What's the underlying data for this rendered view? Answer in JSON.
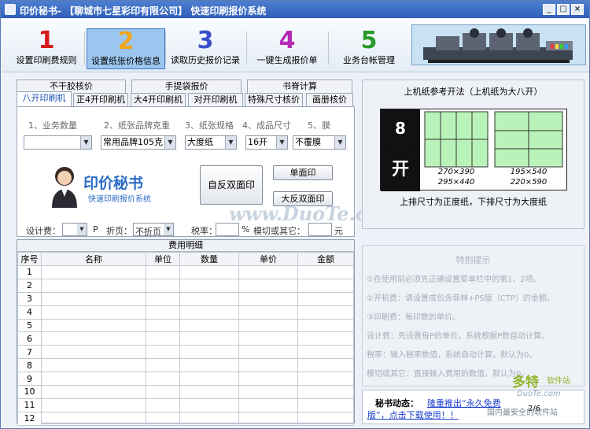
{
  "window": {
    "title": "印价秘书- 【聊城市七星彩印有限公司】 快速印刷报价系统",
    "controls": [
      "_",
      "□",
      "×"
    ]
  },
  "toolbar": {
    "buttons": [
      {
        "num": "1",
        "label": "设置印刷费规则",
        "color": "#d51a1a"
      },
      {
        "num": "2",
        "label": "设置纸张价格信息",
        "color": "#f0a51a"
      },
      {
        "num": "3",
        "label": "读取历史报价记录",
        "color": "#3a4fc8"
      },
      {
        "num": "4",
        "label": "一键生成报价单",
        "color": "#b52ab5"
      },
      {
        "num": "5",
        "label": "业务台帐管理",
        "color": "#2a9a2a"
      }
    ]
  },
  "tabs_row1": [
    "不干胶核价",
    "手提袋报价",
    "书脊计算"
  ],
  "tabs_row2": [
    "八开印刷机",
    "正4开印刷机",
    "大4开印刷机",
    "对开印刷机",
    "特殊尺寸核价",
    "画册核价"
  ],
  "form": {
    "labels": [
      "1、业务数量",
      "2、纸张品牌克重",
      "3、纸张规格",
      "4、成品尺寸",
      "5、膜"
    ],
    "values": [
      "",
      "常用品牌105克",
      "大度纸",
      "16开",
      "不覆膜"
    ]
  },
  "logo": {
    "title": "印价秘书",
    "subtitle": "快速印刷报价系统"
  },
  "buttons": {
    "duplex": "自反双面印",
    "single": "单面印",
    "big_duplex": "大反双面印"
  },
  "fees": {
    "design_label": "设计费：",
    "design_unit": "P",
    "fold_label": "折页：",
    "fold_value": "不折页",
    "tax_label": "税率：",
    "tax_unit": "%",
    "cut_label": "模切或其它：",
    "cut_unit": "元"
  },
  "table": {
    "title": "费用明细",
    "headers": [
      "序号",
      "名称",
      "单位",
      "数量",
      "单价",
      "金额"
    ],
    "rows": [
      "1",
      "2",
      "3",
      "4",
      "5",
      "6",
      "7",
      "8",
      "9",
      "10",
      "11",
      "12"
    ]
  },
  "right": {
    "title": "上机纸参考开法（上机纸为大八开）",
    "size_num": "8",
    "size_char": "开",
    "top_left": "270×390",
    "bottom_left": "295×440",
    "top_right": "195×540",
    "bottom_right": "220×590",
    "note": "上排尺寸为正度纸，下排尺寸为大度纸"
  },
  "tips": {
    "title": "特别提示",
    "items": [
      "①在使用前必须先正确设置菜单栏中的第1、2项。",
      "②开机费：请设置成包含菲林+PS版（CTP）的金额。",
      "③印刷费：每印数的单价。",
      "设计费：先设置每P的单价，系统根据P数自动计算。",
      "税率：输入税率数值，系统自动计算，默认为0。",
      "模切或其它：直接输入费用的数值，默认为0。"
    ]
  },
  "news": {
    "label": "秘书动态：",
    "text1": "隆重推出“永久免费",
    "text2": "版”，点击下载使用！！",
    "page": "2/6"
  },
  "watermark": "www.DuoTe.com",
  "corner": {
    "brand": "多特",
    "sub": "软件站",
    "site": "DuoTe.com",
    "slogan": "国内最安全的软件站"
  }
}
